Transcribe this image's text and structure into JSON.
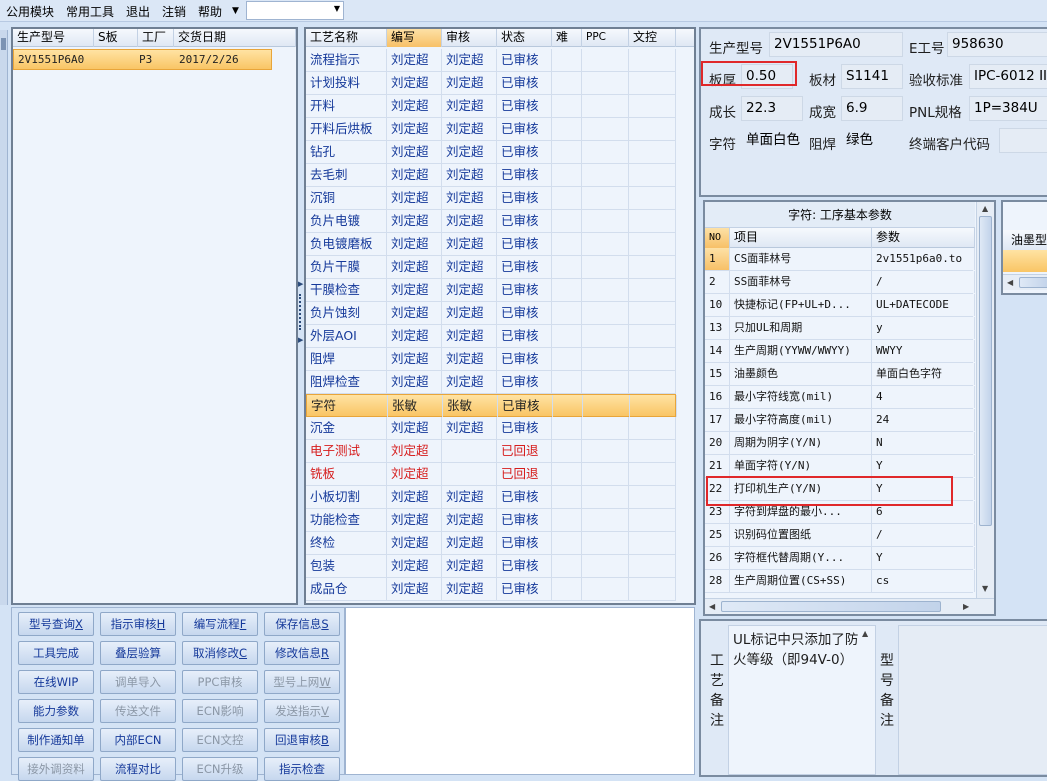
{
  "menubar": {
    "items": [
      "公用模块",
      "常用工具",
      "退出",
      "注销",
      "帮助"
    ],
    "combo_value": ""
  },
  "orders": {
    "headers": [
      "生产型号",
      "S板",
      "工厂",
      "交货日期"
    ],
    "rows": [
      {
        "model": "2V1551P6A0",
        "s_board": "",
        "factory": "P3",
        "date": "2017/2/26"
      }
    ]
  },
  "process": {
    "headers": [
      "工艺名称",
      "编写",
      "审核",
      "状态",
      "难",
      "PPC",
      "文控"
    ],
    "rows": [
      {
        "name": "流程指示",
        "author": "刘定超",
        "reviewer": "刘定超",
        "status": "已审核"
      },
      {
        "name": "计划投料",
        "author": "刘定超",
        "reviewer": "刘定超",
        "status": "已审核"
      },
      {
        "name": "开料",
        "author": "刘定超",
        "reviewer": "刘定超",
        "status": "已审核"
      },
      {
        "name": "开料后烘板",
        "author": "刘定超",
        "reviewer": "刘定超",
        "status": "已审核"
      },
      {
        "name": "钻孔",
        "author": "刘定超",
        "reviewer": "刘定超",
        "status": "已审核"
      },
      {
        "name": "去毛刺",
        "author": "刘定超",
        "reviewer": "刘定超",
        "status": "已审核"
      },
      {
        "name": "沉铜",
        "author": "刘定超",
        "reviewer": "刘定超",
        "status": "已审核"
      },
      {
        "name": "负片电镀",
        "author": "刘定超",
        "reviewer": "刘定超",
        "status": "已审核"
      },
      {
        "name": "负电镀磨板",
        "author": "刘定超",
        "reviewer": "刘定超",
        "status": "已审核"
      },
      {
        "name": "负片干膜",
        "author": "刘定超",
        "reviewer": "刘定超",
        "status": "已审核"
      },
      {
        "name": "干膜检查",
        "author": "刘定超",
        "reviewer": "刘定超",
        "status": "已审核"
      },
      {
        "name": "负片蚀刻",
        "author": "刘定超",
        "reviewer": "刘定超",
        "status": "已审核"
      },
      {
        "name": "外层AOI",
        "author": "刘定超",
        "reviewer": "刘定超",
        "status": "已审核"
      },
      {
        "name": "阻焊",
        "author": "刘定超",
        "reviewer": "刘定超",
        "status": "已审核"
      },
      {
        "name": "阻焊检查",
        "author": "刘定超",
        "reviewer": "刘定超",
        "status": "已审核"
      },
      {
        "name": "字符",
        "author": "张敏",
        "reviewer": "张敏",
        "status": "已审核"
      },
      {
        "name": "沉金",
        "author": "刘定超",
        "reviewer": "刘定超",
        "status": "已审核"
      },
      {
        "name": "电子测试",
        "author": "刘定超",
        "reviewer": "",
        "status": "已回退"
      },
      {
        "name": "铣板",
        "author": "刘定超",
        "reviewer": "",
        "status": "已回退"
      },
      {
        "name": "小板切割",
        "author": "刘定超",
        "reviewer": "刘定超",
        "status": "已审核"
      },
      {
        "name": "功能检查",
        "author": "刘定超",
        "reviewer": "刘定超",
        "status": "已审核"
      },
      {
        "name": "终检",
        "author": "刘定超",
        "reviewer": "刘定超",
        "status": "已审核"
      },
      {
        "name": "包装",
        "author": "刘定超",
        "reviewer": "刘定超",
        "status": "已审核"
      },
      {
        "name": "成品仓",
        "author": "刘定超",
        "reviewer": "刘定超",
        "status": "已审核"
      }
    ]
  },
  "info": {
    "model_label": "生产型号",
    "model_value": "2V1551P6A0",
    "e_label": "E工号",
    "e_value": "958630",
    "thickness_label": "板厚",
    "thickness_value": "0.50",
    "material_label": "板材",
    "material_value": "S1141",
    "standard_label": "验收标准",
    "standard_value": "IPC-6012 II",
    "length_label": "成长",
    "length_value": "22.3",
    "width_label": "成宽",
    "width_value": "6.9",
    "pnl_label": "PNL规格",
    "pnl_value": "1P=384U",
    "char_label": "字符",
    "char_value": "单面白色",
    "mask_label": "阻焊",
    "mask_value": "绿色",
    "customer_label": "终端客户代码",
    "customer_value": ""
  },
  "params": {
    "title": "字符: 工序基本参数",
    "headers": [
      "NO",
      "项目",
      "参数"
    ],
    "rows": [
      {
        "no": "1",
        "item": "CS面菲林号",
        "value": "2v1551p6a0.to"
      },
      {
        "no": "2",
        "item": "SS面菲林号",
        "value": "/"
      },
      {
        "no": "10",
        "item": "快捷标记(FP+UL+D...",
        "value": "UL+DATECODE"
      },
      {
        "no": "13",
        "item": "只加UL和周期",
        "value": "y"
      },
      {
        "no": "14",
        "item": "生产周期(YYWW/WWYY)",
        "value": "WWYY"
      },
      {
        "no": "15",
        "item": "油墨颜色",
        "value": "单面白色字符"
      },
      {
        "no": "16",
        "item": "最小字符线宽(mil)",
        "value": "4"
      },
      {
        "no": "17",
        "item": "最小字符高度(mil)",
        "value": "24"
      },
      {
        "no": "20",
        "item": "周期为阴字(Y/N)",
        "value": "N"
      },
      {
        "no": "21",
        "item": "单面字符(Y/N)",
        "value": "Y"
      },
      {
        "no": "22",
        "item": "打印机生产(Y/N)",
        "value": "Y"
      },
      {
        "no": "23",
        "item": "字符到焊盘的最小...",
        "value": "6"
      },
      {
        "no": "25",
        "item": "识别码位置图纸",
        "value": "/"
      },
      {
        "no": "26",
        "item": "字符框代替周期(Y...",
        "value": "Y"
      },
      {
        "no": "28",
        "item": "生产周期位置(CS+SS)",
        "value": "cs"
      }
    ]
  },
  "ink_panel": {
    "label": "油墨型"
  },
  "buttons": [
    {
      "label": "型号查询",
      "key": "X",
      "enabled": true
    },
    {
      "label": "指示审核",
      "key": "H",
      "enabled": true
    },
    {
      "label": "编写流程",
      "key": "F",
      "enabled": true
    },
    {
      "label": "保存信息",
      "key": "S",
      "enabled": true
    },
    {
      "label": "工具完成",
      "key": "",
      "enabled": true
    },
    {
      "label": "叠层验算",
      "key": "",
      "enabled": true
    },
    {
      "label": "取消修改",
      "key": "C",
      "enabled": true
    },
    {
      "label": "修改信息",
      "key": "R",
      "enabled": true
    },
    {
      "label": "在线WIP",
      "key": "",
      "enabled": true
    },
    {
      "label": "调单导入",
      "key": "",
      "enabled": false
    },
    {
      "label": "PPC审核",
      "key": "",
      "enabled": false
    },
    {
      "label": "型号上网",
      "key": "W",
      "enabled": false
    },
    {
      "label": "能力参数",
      "key": "",
      "enabled": true
    },
    {
      "label": "传送文件",
      "key": "",
      "enabled": false
    },
    {
      "label": "ECN影响",
      "key": "",
      "enabled": false
    },
    {
      "label": "发送指示",
      "key": "V",
      "enabled": false
    },
    {
      "label": "制作通知单",
      "key": "",
      "enabled": true
    },
    {
      "label": "内部ECN",
      "key": "",
      "enabled": true
    },
    {
      "label": "ECN文控",
      "key": "",
      "enabled": false
    },
    {
      "label": "回退审核",
      "key": "B",
      "enabled": true
    },
    {
      "label": "接外调资料",
      "key": "",
      "enabled": false
    },
    {
      "label": "流程对比",
      "key": "",
      "enabled": true
    },
    {
      "label": "ECN升级",
      "key": "",
      "enabled": false
    },
    {
      "label": "指示检查",
      "key": "",
      "enabled": true
    }
  ],
  "remarks": {
    "process_label": "工艺备注",
    "process_text": "UL标记中只添加了防火等级（即94V-0）",
    "model_label": "型号备注",
    "model_text": ""
  },
  "colors": {
    "highlight": "#e0282a",
    "selected_row": "#f9c565",
    "link_text": "#15399a",
    "rollback_text": "#d61c1c"
  }
}
